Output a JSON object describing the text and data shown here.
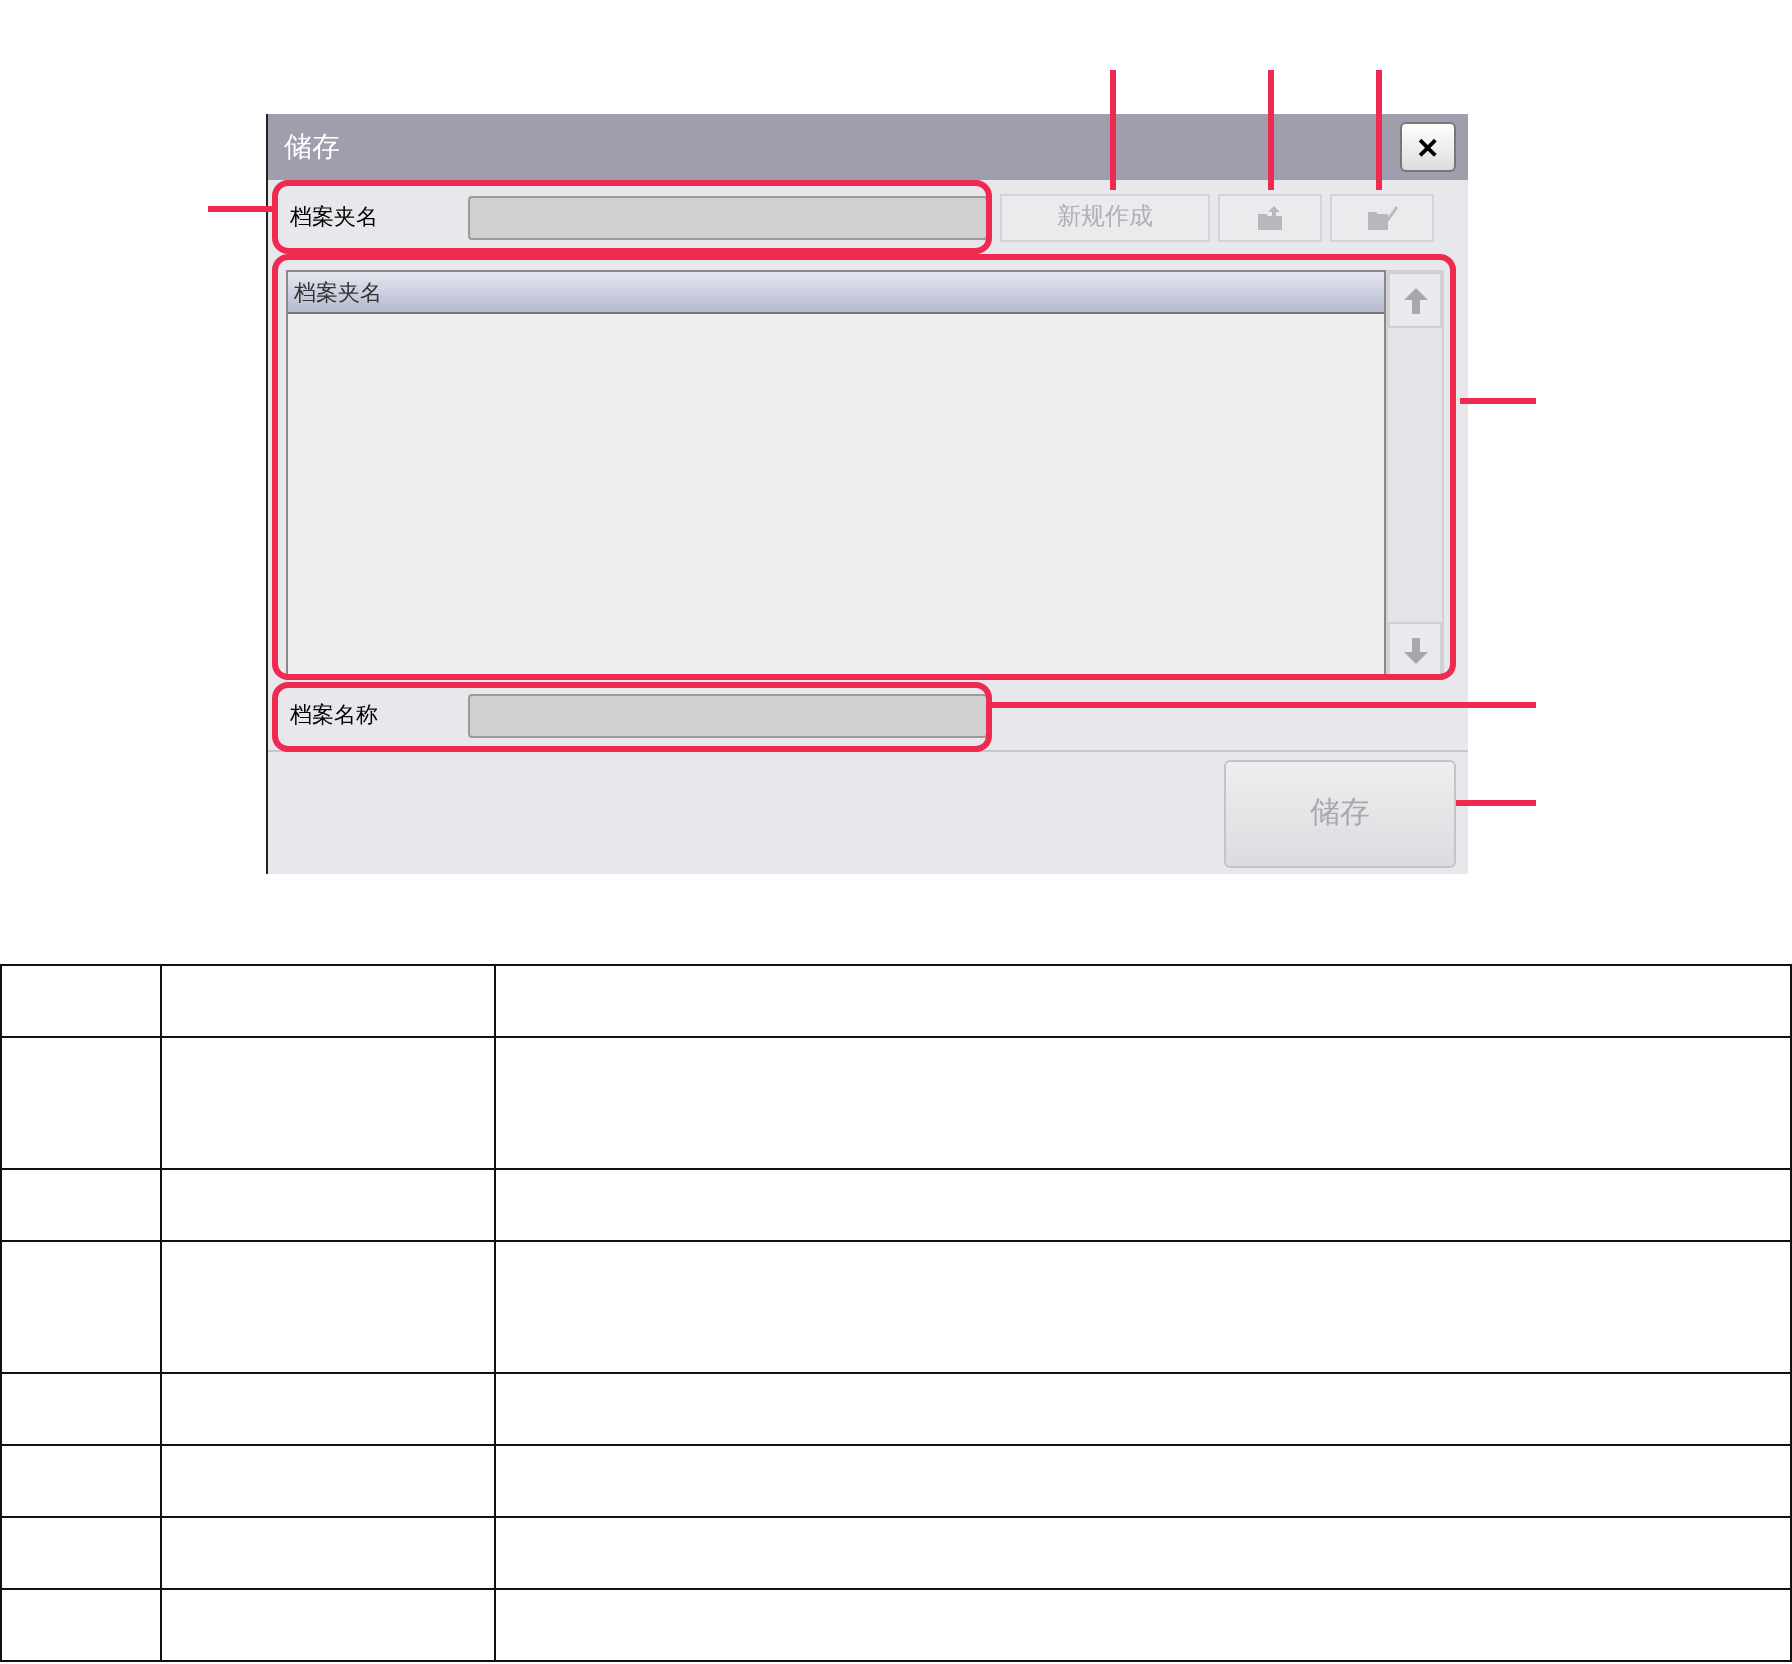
{
  "window": {
    "title": "储存",
    "close": "✕"
  },
  "folder_row": {
    "label": "档案夹名",
    "button": "新规作成"
  },
  "folder_list": {
    "columns": [
      "档案夹名"
    ]
  },
  "file_row": {
    "label": "档案名称"
  },
  "save_button": "储存",
  "description_table": {
    "rows": [
      {
        "kind": "normal"
      },
      {
        "kind": "tall"
      },
      {
        "kind": "normal"
      },
      {
        "kind": "tall"
      },
      {
        "kind": "normal"
      },
      {
        "kind": "normal"
      },
      {
        "kind": "normal"
      },
      {
        "kind": "normal"
      }
    ]
  }
}
